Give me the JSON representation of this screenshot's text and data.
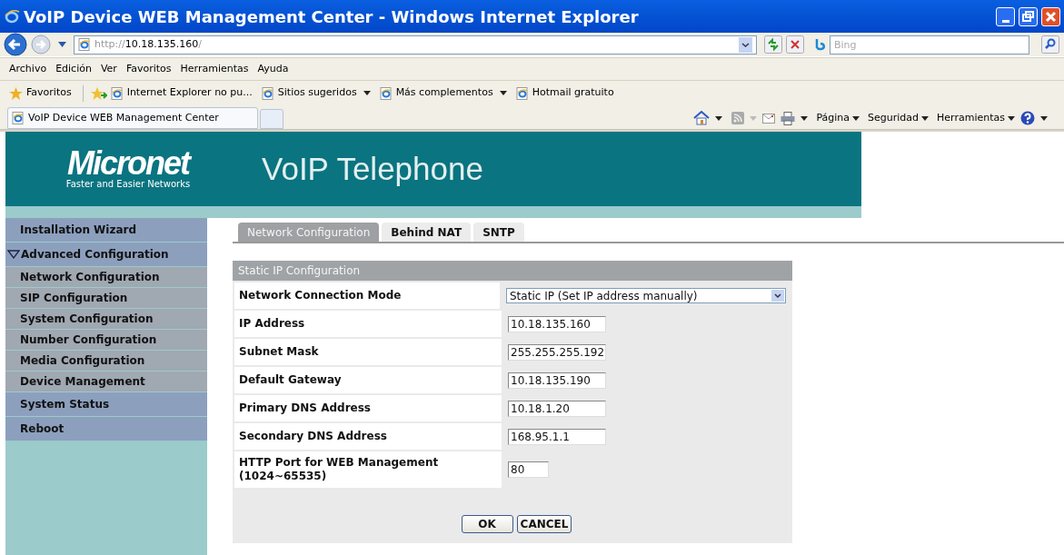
{
  "window": {
    "title": "VoIP Device WEB Management Center - Windows Internet Explorer"
  },
  "address_bar": {
    "prefix": "http://",
    "host": "10.18.135.160",
    "suffix": "/"
  },
  "search": {
    "placeholder": "Bing"
  },
  "menu": [
    "Archivo",
    "Edición",
    "Ver",
    "Favoritos",
    "Herramientas",
    "Ayuda"
  ],
  "favorites_bar": {
    "label": "Favoritos",
    "links": [
      {
        "label": "Internet Explorer no pu...",
        "dropdown": false
      },
      {
        "label": "Sitios sugeridos",
        "dropdown": true
      },
      {
        "label": "Más complementos",
        "dropdown": true
      },
      {
        "label": "Hotmail gratuito",
        "dropdown": false
      }
    ]
  },
  "browser_tab": {
    "title": "VoIP Device WEB Management Center"
  },
  "command_bar": [
    "Página",
    "Seguridad",
    "Herramientas"
  ],
  "header": {
    "logo": "Micronet",
    "tagline": "Faster and Easier Networks",
    "title": "VoIP Telephone"
  },
  "sidebar": {
    "items": [
      {
        "kind": "top",
        "label": "Installation Wizard"
      },
      {
        "kind": "top",
        "label": "Advanced Configuration",
        "expanded": true,
        "children": [
          {
            "label": "Network Configuration"
          },
          {
            "label": "SIP Configuration"
          },
          {
            "label": "System Configuration"
          },
          {
            "label": "Number Configuration"
          },
          {
            "label": "Media Configuration"
          },
          {
            "label": "Device Management"
          }
        ]
      },
      {
        "kind": "top",
        "label": "System Status"
      },
      {
        "kind": "top",
        "label": "Reboot"
      }
    ]
  },
  "tabs": [
    {
      "label": "Network Configuration",
      "selected": true
    },
    {
      "label": "Behind NAT",
      "selected": false
    },
    {
      "label": "SNTP",
      "selected": false
    }
  ],
  "form": {
    "title": "Static IP Configuration",
    "rows": [
      {
        "kind": "select",
        "label": "Network Connection Mode",
        "value": "Static IP (Set IP address manually)"
      },
      {
        "kind": "text",
        "label": "IP Address",
        "value": "10.18.135.160"
      },
      {
        "kind": "text",
        "label": "Subnet Mask",
        "value": "255.255.255.192"
      },
      {
        "kind": "text",
        "label": "Default Gateway",
        "value": "10.18.135.190"
      },
      {
        "kind": "text",
        "label": "Primary DNS Address",
        "value": "10.18.1.20"
      },
      {
        "kind": "text",
        "label": "Secondary DNS Address",
        "value": "168.95.1.1"
      },
      {
        "kind": "short",
        "label": "HTTP Port for WEB Management (1024~65535)",
        "value": "80"
      }
    ],
    "buttons": [
      "OK",
      "CANCEL"
    ]
  }
}
